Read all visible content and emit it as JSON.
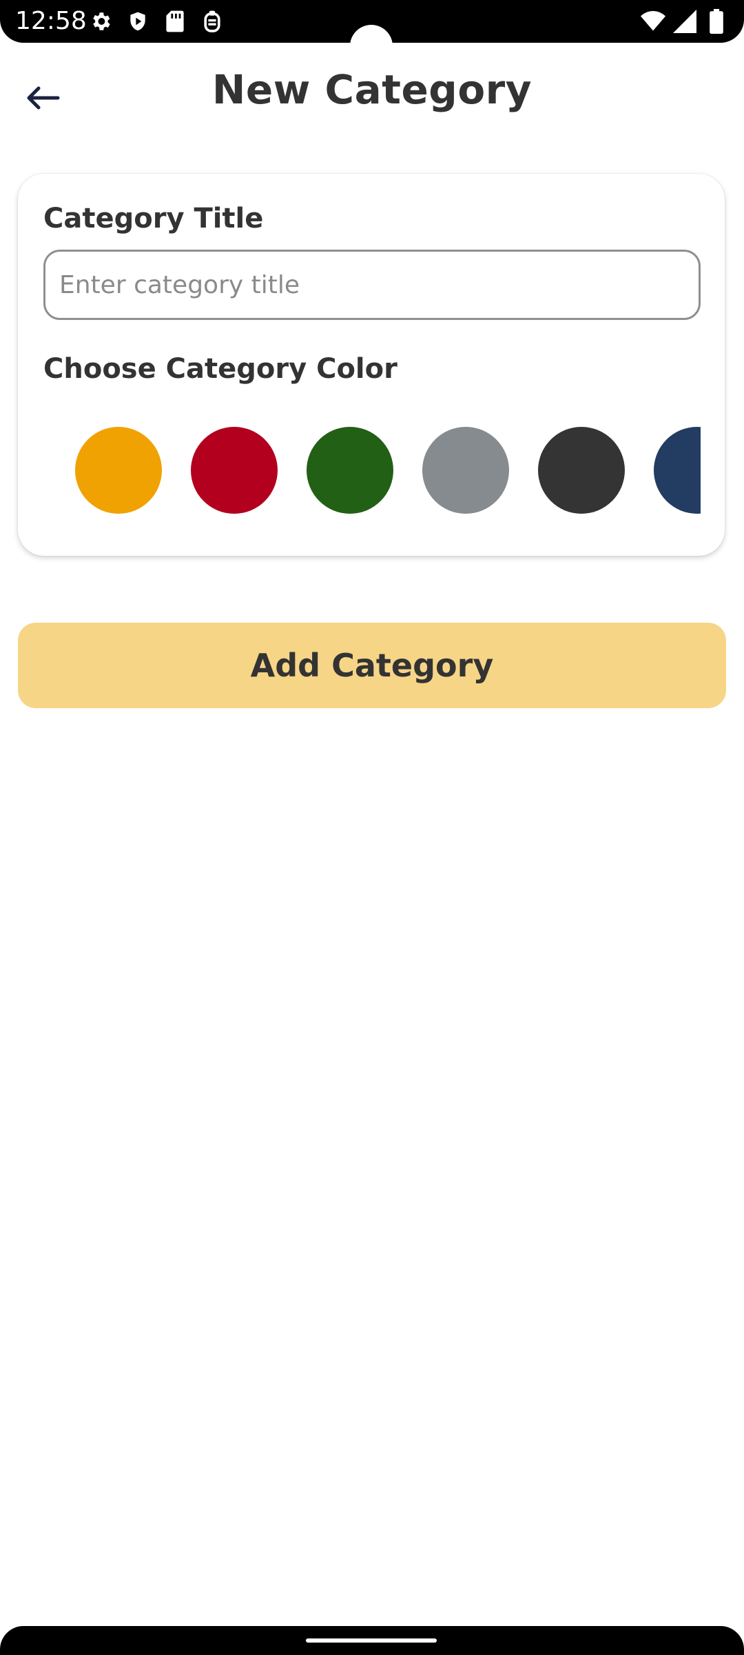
{
  "status_bar": {
    "time": "12:58",
    "left_icons": [
      "settings-icon",
      "shield-play-icon",
      "sd-card-icon",
      "clipboard-icon"
    ],
    "right_icons": [
      "wifi-icon",
      "signal-icon",
      "battery-icon"
    ]
  },
  "header": {
    "title": "New Category",
    "back_icon": "arrow-left-icon"
  },
  "form": {
    "title_label": "Category Title",
    "title_placeholder": "Enter category title",
    "title_value": "",
    "color_label": "Choose Category Color",
    "colors": [
      {
        "name": "orange",
        "hex": "#f0a202"
      },
      {
        "name": "red",
        "hex": "#b3001e"
      },
      {
        "name": "green",
        "hex": "#226015"
      },
      {
        "name": "gray",
        "hex": "#858b8e"
      },
      {
        "name": "dark-gray",
        "hex": "#343434"
      },
      {
        "name": "navy",
        "hex": "#223c62"
      }
    ]
  },
  "actions": {
    "add_label": "Add Category"
  },
  "colors": {
    "primary_button": "#f6d587",
    "text": "#333333"
  }
}
